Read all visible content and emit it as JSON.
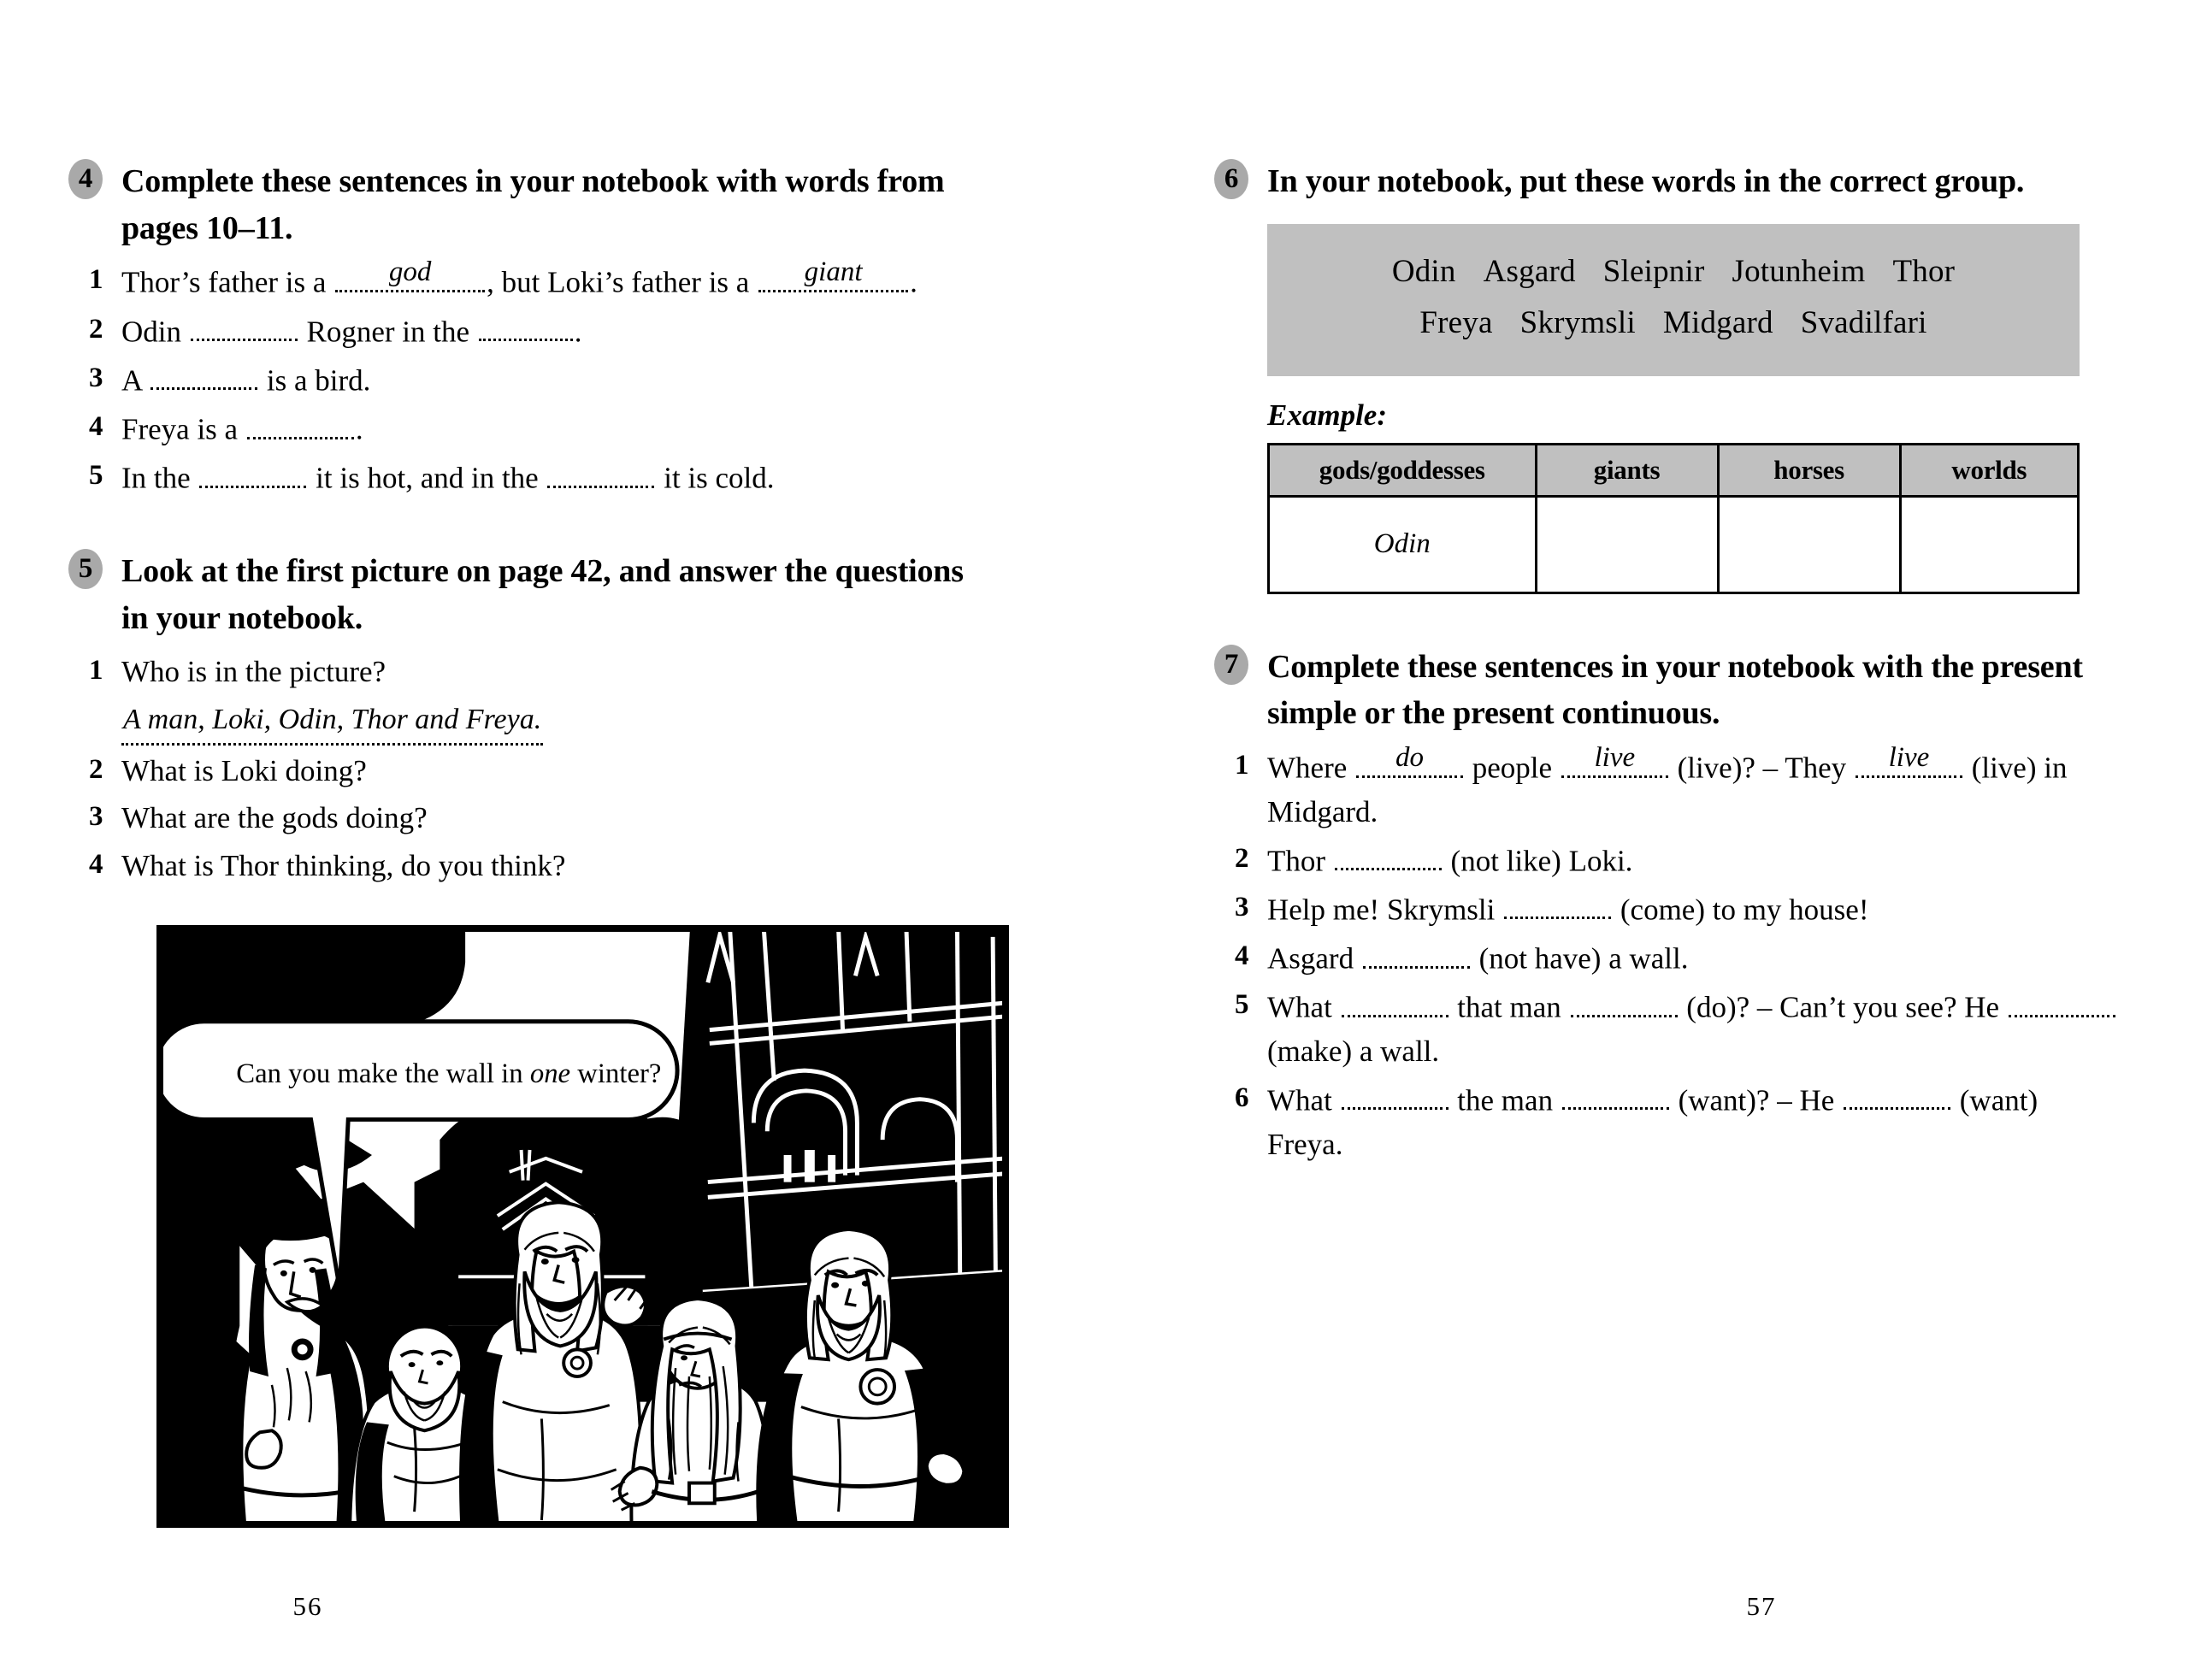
{
  "left_page": {
    "folio": "56",
    "exercises": [
      {
        "number": "4",
        "heading": "Complete these sentences in your notebook with words from pages 10–11.",
        "items": [
          {
            "num": "1",
            "parts": [
              {
                "t": "text",
                "v": "Thor’s father is a "
              },
              {
                "t": "blank",
                "answer": "god",
                "size": "w-l"
              },
              {
                "t": "text",
                "v": ", but Loki’s father is a "
              },
              {
                "t": "blank",
                "answer": "giant",
                "size": "w-l"
              },
              {
                "t": "text",
                "v": "."
              }
            ]
          },
          {
            "num": "2",
            "parts": [
              {
                "t": "text",
                "v": "Odin "
              },
              {
                "t": "blank",
                "answer": "",
                "size": "w-m"
              },
              {
                "t": "text",
                "v": " Rogner in the "
              },
              {
                "t": "blank",
                "answer": "",
                "size": "w-s"
              },
              {
                "t": "text",
                "v": "."
              }
            ]
          },
          {
            "num": "3",
            "parts": [
              {
                "t": "text",
                "v": "A "
              },
              {
                "t": "blank",
                "answer": "",
                "size": "w-m"
              },
              {
                "t": "text",
                "v": " is a bird."
              }
            ]
          },
          {
            "num": "4",
            "parts": [
              {
                "t": "text",
                "v": "Freya is a "
              },
              {
                "t": "blank",
                "answer": "",
                "size": "w-m"
              },
              {
                "t": "text",
                "v": "."
              }
            ]
          },
          {
            "num": "5",
            "parts": [
              {
                "t": "text",
                "v": "In the "
              },
              {
                "t": "blank",
                "answer": "",
                "size": "w-m"
              },
              {
                "t": "text",
                "v": " it is hot, and in the "
              },
              {
                "t": "blank",
                "answer": "",
                "size": "w-m"
              },
              {
                "t": "text",
                "v": " it is cold."
              }
            ]
          }
        ]
      },
      {
        "number": "5",
        "heading": "Look at the first picture on page 42, and answer the questions in your notebook.",
        "items": [
          {
            "num": "1",
            "parts": [
              {
                "t": "text",
                "v": "Who is in the picture?"
              }
            ],
            "answer_line": "A man, Loki, Odin, Thor and Freya."
          },
          {
            "num": "2",
            "parts": [
              {
                "t": "text",
                "v": "What is Loki doing?"
              }
            ]
          },
          {
            "num": "3",
            "parts": [
              {
                "t": "text",
                "v": "What are the gods doing?"
              }
            ]
          },
          {
            "num": "4",
            "parts": [
              {
                "t": "text",
                "v": "What is Thor thinking, do you think?"
              }
            ]
          }
        ]
      }
    ],
    "comic": {
      "alt": "Black and white comic panel: Loki, a dwarf, Odin, Freya and Thor standing before dark Asgard buildings at night",
      "speech_bubble": {
        "before": "Can you make the wall in ",
        "italic": "one",
        "after": " winter?"
      }
    }
  },
  "right_page": {
    "folio": "57",
    "exercises": [
      {
        "number": "6",
        "heading": "In your notebook, put these words in the correct group.",
        "word_bank": [
          [
            "Odin",
            "Asgard",
            "Sleipnir",
            "Jotunheim",
            "Thor"
          ],
          [
            "Freya",
            "Skrymsli",
            "Midgard",
            "Svadilfari"
          ]
        ],
        "example_label": "Example:",
        "table": {
          "headers": [
            "gods/goddesses",
            "giants",
            "horses",
            "worlds"
          ],
          "rows": [
            [
              "Odin",
              "",
              "",
              ""
            ]
          ]
        }
      },
      {
        "number": "7",
        "heading": "Complete these sentences in your notebook with the present simple or the present continuous.",
        "items": [
          {
            "num": "1",
            "parts": [
              {
                "t": "text",
                "v": "Where "
              },
              {
                "t": "blank",
                "answer": "do",
                "size": "w-m"
              },
              {
                "t": "text",
                "v": " people "
              },
              {
                "t": "blank",
                "answer": "live",
                "size": "w-m"
              },
              {
                "t": "text",
                "v": " (live)? – They "
              },
              {
                "t": "blank",
                "answer": "live",
                "size": "w-m"
              },
              {
                "t": "text",
                "v": " (live) in Midgard."
              }
            ]
          },
          {
            "num": "2",
            "parts": [
              {
                "t": "text",
                "v": "Thor "
              },
              {
                "t": "blank",
                "answer": "",
                "size": "w-m"
              },
              {
                "t": "text",
                "v": " (not like) Loki."
              }
            ]
          },
          {
            "num": "3",
            "parts": [
              {
                "t": "text",
                "v": "Help me! Skrymsli  "
              },
              {
                "t": "blank",
                "answer": "",
                "size": "w-m"
              },
              {
                "t": "text",
                "v": " (come) to my house!"
              }
            ]
          },
          {
            "num": "4",
            "parts": [
              {
                "t": "text",
                "v": "Asgard "
              },
              {
                "t": "blank",
                "answer": "",
                "size": "w-m"
              },
              {
                "t": "text",
                "v": " (not have) a wall."
              }
            ]
          },
          {
            "num": "5",
            "parts": [
              {
                "t": "text",
                "v": "What "
              },
              {
                "t": "blank",
                "answer": "",
                "size": "w-m"
              },
              {
                "t": "text",
                "v": " that man "
              },
              {
                "t": "blank",
                "answer": "",
                "size": "w-m"
              },
              {
                "t": "text",
                "v": " (do)? – Can’t you see? He  "
              },
              {
                "t": "blank",
                "answer": "",
                "size": "w-m"
              },
              {
                "t": "text",
                "v": " (make) a wall."
              }
            ]
          },
          {
            "num": "6",
            "parts": [
              {
                "t": "text",
                "v": "What "
              },
              {
                "t": "blank",
                "answer": "",
                "size": "w-m"
              },
              {
                "t": "text",
                "v": " the man "
              },
              {
                "t": "blank",
                "answer": "",
                "size": "w-m"
              },
              {
                "t": "text",
                "v": " (want)? – He "
              },
              {
                "t": "blank",
                "answer": "",
                "size": "w-m"
              },
              {
                "t": "text",
                "v": " (want) Freya."
              }
            ]
          }
        ]
      }
    ]
  },
  "colors": {
    "badge_gray": "#a9a9a9",
    "panel_gray": "#c0c0c0",
    "ink": "#000000",
    "paper": "#ffffff"
  }
}
